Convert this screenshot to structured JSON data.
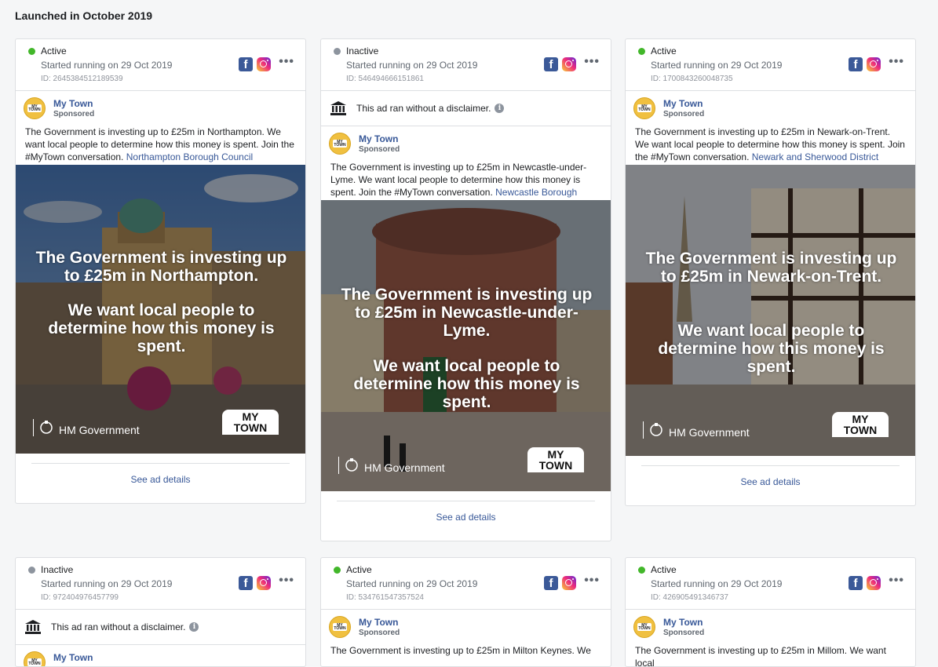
{
  "section": {
    "title": "Launched in October 2019"
  },
  "common": {
    "page_name": "My Town",
    "sponsored": "Sponsored",
    "disclaimer": "This ad ran without a disclaimer.",
    "see_details": "See ad details",
    "hm_government": "HM Government",
    "badge_line1": "MY",
    "badge_line2": "TOWN",
    "avatar_text": "MY TOWN",
    "overlay_line2": "We want local people to determine how this money is spent."
  },
  "colors": {
    "active": "#42b72a",
    "inactive": "#8d949e",
    "link": "#385898"
  },
  "cards": [
    {
      "status": "Active",
      "started": "Started running on 29 Oct 2019",
      "id": "ID: 2645384512189539",
      "text": "The Government is investing up to £25m in Northampton. We want local people to determine how this money is spent. Join the #MyTown conversation.",
      "link": "Northampton Borough Council",
      "overlay": "The Government is investing up to £25m in Northampton."
    },
    {
      "status": "Inactive",
      "started": "Started running on 29 Oct 2019",
      "id": "ID: 546494666151861",
      "text": "The Government is investing up to £25m in Newcastle-under-Lyme. We want local people to determine how this money is spent. Join the #MyTown conversation.",
      "link": "Newcastle Borough Council",
      "overlay": "The Government is investing up to £25m in Newcastle-under-Lyme."
    },
    {
      "status": "Active",
      "started": "Started running on 29 Oct 2019",
      "id": "ID: 1700843260048735",
      "text": "The Government is investing up to £25m in Newark-on-Trent. We want local people to determine how this money is spent. Join the #MyTown conversation.",
      "link": "Newark and Sherwood District Council",
      "overlay": "The Government is investing up to £25m in Newark-on-Trent."
    },
    {
      "status": "Inactive",
      "started": "Started running on 29 Oct 2019",
      "id": "ID: 972404976457799",
      "text": "",
      "link": ""
    },
    {
      "status": "Active",
      "started": "Started running on 29 Oct 2019",
      "id": "ID: 534761547357524",
      "text": "The Government is investing up to £25m in Milton Keynes. We",
      "link": ""
    },
    {
      "status": "Active",
      "started": "Started running on 29 Oct 2019",
      "id": "ID: 426905491346737",
      "text": "The Government is investing up to £25m in Millom. We want local",
      "link": ""
    }
  ]
}
